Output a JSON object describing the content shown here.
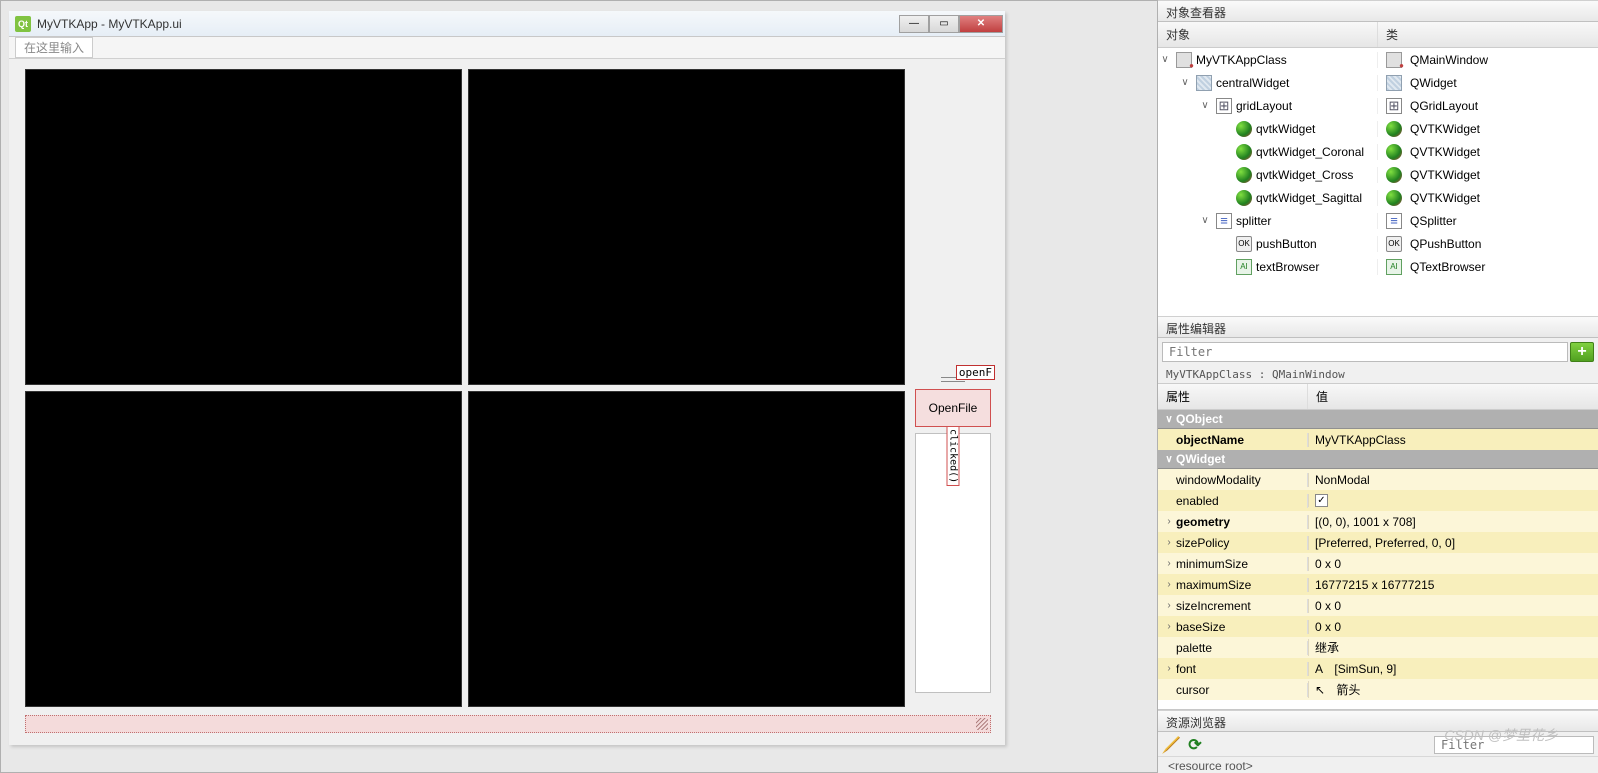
{
  "window": {
    "title": "MyVTKApp - MyVTKApp.ui"
  },
  "menubar": {
    "typeHere": "在这里输入"
  },
  "signals": {
    "slot": "openF",
    "button": "OpenFile",
    "clicked": "clicked()"
  },
  "objInspector": {
    "title": "对象查看器",
    "cols": {
      "object": "对象",
      "class": "类"
    },
    "tree": [
      {
        "name": "MyVTKAppClass",
        "cls": "QMainWindow",
        "indent": 0,
        "exp": "v",
        "icon": "main"
      },
      {
        "name": "centralWidget",
        "cls": "QWidget",
        "indent": 1,
        "exp": "v",
        "icon": "widget"
      },
      {
        "name": "gridLayout",
        "cls": "QGridLayout",
        "indent": 2,
        "exp": "v",
        "icon": "grid"
      },
      {
        "name": "qvtkWidget",
        "cls": "QVTKWidget",
        "indent": 3,
        "icon": "vtk"
      },
      {
        "name": "qvtkWidget_Coronal",
        "cls": "QVTKWidget",
        "indent": 3,
        "icon": "vtk"
      },
      {
        "name": "qvtkWidget_Cross",
        "cls": "QVTKWidget",
        "indent": 3,
        "icon": "vtk"
      },
      {
        "name": "qvtkWidget_Sagittal",
        "cls": "QVTKWidget",
        "indent": 3,
        "icon": "vtk"
      },
      {
        "name": "splitter",
        "cls": "QSplitter",
        "indent": 2,
        "exp": "v",
        "icon": "split"
      },
      {
        "name": "pushButton",
        "cls": "QPushButton",
        "indent": 3,
        "icon": "btn"
      },
      {
        "name": "textBrowser",
        "cls": "QTextBrowser",
        "indent": 3,
        "icon": "txt"
      }
    ]
  },
  "propEditor": {
    "title": "属性编辑器",
    "filterPlaceholder": "Filter",
    "classLine": "MyVTKAppClass : QMainWindow",
    "cols": {
      "prop": "属性",
      "val": "值"
    },
    "groups": {
      "qobject": "QObject",
      "qwidget": "QWidget"
    },
    "rows": {
      "objectName": {
        "k": "objectName",
        "v": "MyVTKAppClass"
      },
      "windowModality": {
        "k": "windowModality",
        "v": "NonModal"
      },
      "enabled": {
        "k": "enabled",
        "v": true
      },
      "geometry": {
        "k": "geometry",
        "v": "[(0, 0), 1001 x 708]"
      },
      "sizePolicy": {
        "k": "sizePolicy",
        "v": "[Preferred, Preferred, 0, 0]"
      },
      "minimumSize": {
        "k": "minimumSize",
        "v": "0 x 0"
      },
      "maximumSize": {
        "k": "maximumSize",
        "v": "16777215 x 16777215"
      },
      "sizeIncrement": {
        "k": "sizeIncrement",
        "v": "0 x 0"
      },
      "baseSize": {
        "k": "baseSize",
        "v": "0 x 0"
      },
      "palette": {
        "k": "palette",
        "v": "继承"
      },
      "font": {
        "k": "font",
        "v": "[SimSun, 9]"
      },
      "cursor": {
        "k": "cursor",
        "v": "箭头"
      }
    }
  },
  "resBrowser": {
    "title": "资源浏览器",
    "filterPlaceholder": "Filter",
    "root": "<resource root>"
  },
  "watermark": "CSDN @梦里花乡"
}
